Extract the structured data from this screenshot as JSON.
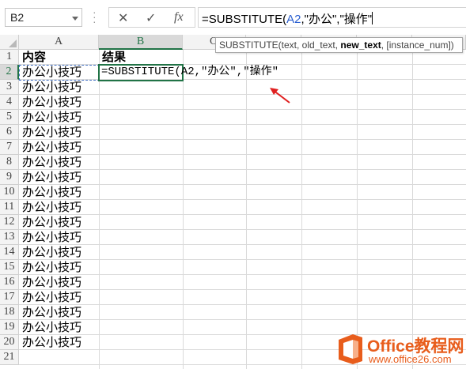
{
  "name_box": {
    "value": "B2"
  },
  "formula_bar": {
    "cancel_icon": "✕",
    "enter_icon": "✓",
    "fx_icon": "fx",
    "formula_prefix": "=SUBSTITUTE(",
    "formula_ref": "A2",
    "formula_suffix": ",\"办公\",\"操作\""
  },
  "tooltip": {
    "fn": "SUBSTITUTE(",
    "args_before": "text, old_text, ",
    "current_arg": "new_text",
    "args_after": ", [instance_num])"
  },
  "columns": [
    "A",
    "B",
    "C"
  ],
  "rows": [
    "1",
    "2",
    "3",
    "4",
    "5",
    "6",
    "7",
    "8",
    "9",
    "10",
    "11",
    "12",
    "13",
    "14",
    "15",
    "16",
    "17",
    "18",
    "19",
    "20",
    "21"
  ],
  "cells": {
    "A1": "内容",
    "B1": "结果",
    "B2": "=SUBSTITUTE(A2,\"办公\",\"操作\"",
    "A_values": [
      "办公小技巧",
      "办公小技巧",
      "办公小技巧",
      "办公小技巧",
      "办公小技巧",
      "办公小技巧",
      "办公小技巧",
      "办公小技巧",
      "办公小技巧",
      "办公小技巧",
      "办公小技巧",
      "办公小技巧",
      "办公小技巧",
      "办公小技巧",
      "办公小技巧",
      "办公小技巧",
      "办公小技巧",
      "办公小技巧",
      "办公小技巧"
    ]
  },
  "watermark": {
    "brand": "Office教程网",
    "url": "www.office26.com"
  },
  "colors": {
    "accent": "#217346",
    "ref_blue": "#2b5fd0",
    "arrow": "#e02020",
    "watermark": "#e85d1c"
  }
}
